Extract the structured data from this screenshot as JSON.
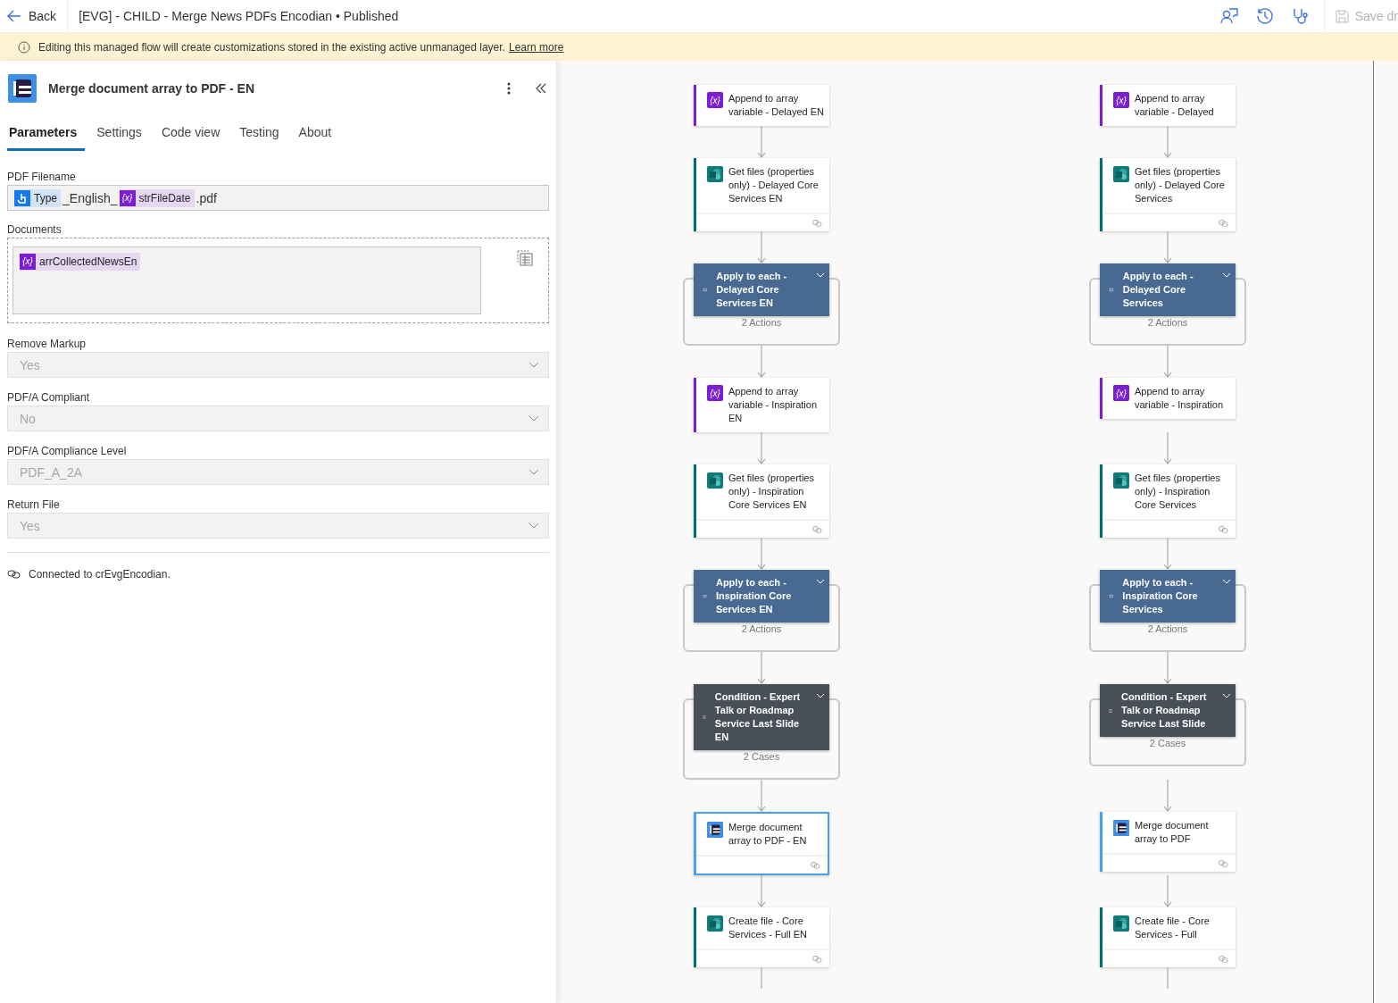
{
  "topbar": {
    "back": "Back",
    "title": "[EVG] - CHILD - Merge News PDFs Encodian • Published",
    "save": "Save dr"
  },
  "banner": {
    "text": "Editing this managed flow will create customizations stored in the existing active unmanaged layer.",
    "link": "Learn more"
  },
  "panel": {
    "title": "Merge document array to PDF - EN",
    "tabs": [
      {
        "label": "Parameters",
        "selected": true
      },
      {
        "label": "Settings",
        "selected": false
      },
      {
        "label": "Code view",
        "selected": false
      },
      {
        "label": "Testing",
        "selected": false
      },
      {
        "label": "About",
        "selected": false
      }
    ],
    "filename": {
      "label": "PDF Filename",
      "parts": [
        {
          "kind": "dynamic",
          "text": "Type"
        },
        {
          "kind": "text",
          "text": "_English_"
        },
        {
          "kind": "variable",
          "icon": "{x}",
          "text": "strFileDate"
        },
        {
          "kind": "text",
          "text": ".pdf"
        }
      ]
    },
    "documents": {
      "label": "Documents",
      "token": {
        "icon": "{x}",
        "text": "arrCollectedNewsEn"
      }
    },
    "dropdowns": [
      {
        "label": "Remove Markup",
        "value": "Yes",
        "disabled": true
      },
      {
        "label": "PDF/A Compliant",
        "value": "No",
        "disabled": true
      },
      {
        "label": "PDF/A Compliance Level",
        "value": "PDF_A_2A",
        "disabled": true
      },
      {
        "label": "Return File",
        "value": "Yes",
        "disabled": true
      }
    ],
    "connection": "Connected to crEvgEncodian."
  },
  "flows": [
    {
      "nodes": [
        {
          "kind": "variable",
          "icon": "{x}",
          "title": "Append to array variable - Delayed EN",
          "selected": false
        },
        {
          "kind": "sharepoint",
          "title": "Get files (properties only) - Delayed Core Services EN",
          "selected": false
        },
        {
          "kind": "loop",
          "title": "Apply to each - Delayed Core Services EN",
          "summary": "2 Actions",
          "selected": false
        },
        {
          "kind": "variable",
          "icon": "{x}",
          "title": "Append to array variable - Inspiration EN",
          "selected": false
        },
        {
          "kind": "sharepoint",
          "title": "Get files (properties only) - Inspiration Core Services EN",
          "selected": false
        },
        {
          "kind": "loop",
          "title": "Apply to each - Inspiration Core Services EN",
          "summary": "2 Actions",
          "selected": false
        },
        {
          "kind": "condition",
          "title": "Condition - Expert Talk or Roadmap Service Last Slide EN",
          "summary": "2 Cases",
          "selected": false
        },
        {
          "kind": "encodian",
          "title": "Merge document array to PDF - EN",
          "selected": true
        },
        {
          "kind": "sharepoint",
          "title": "Create file - Core Services - Full EN",
          "selected": false
        }
      ]
    },
    {
      "nodes": [
        {
          "kind": "variable",
          "icon": "{x}",
          "title": "Append to array variable - Delayed",
          "selected": false
        },
        {
          "kind": "sharepoint",
          "title": "Get files (properties only) - Delayed Core Services",
          "selected": false
        },
        {
          "kind": "loop",
          "title": "Apply to each - Delayed Core Services",
          "summary": "2 Actions",
          "selected": false
        },
        {
          "kind": "variable",
          "icon": "{x}",
          "title": "Append to array variable - Inspiration",
          "selected": false
        },
        {
          "kind": "sharepoint",
          "title": "Get files (properties only) - Inspiration Core Services",
          "selected": false
        },
        {
          "kind": "loop",
          "title": "Apply to each - Inspiration Core Services",
          "summary": "2 Actions",
          "selected": false
        },
        {
          "kind": "condition",
          "title": "Condition - Expert Talk or Roadmap Service Last Slide",
          "summary": "2 Cases",
          "selected": false
        },
        {
          "kind": "encodian",
          "title": "Merge document array to PDF",
          "selected": false
        },
        {
          "kind": "sharepoint",
          "title": "Create file - Core Services - Full",
          "selected": false
        }
      ]
    }
  ]
}
